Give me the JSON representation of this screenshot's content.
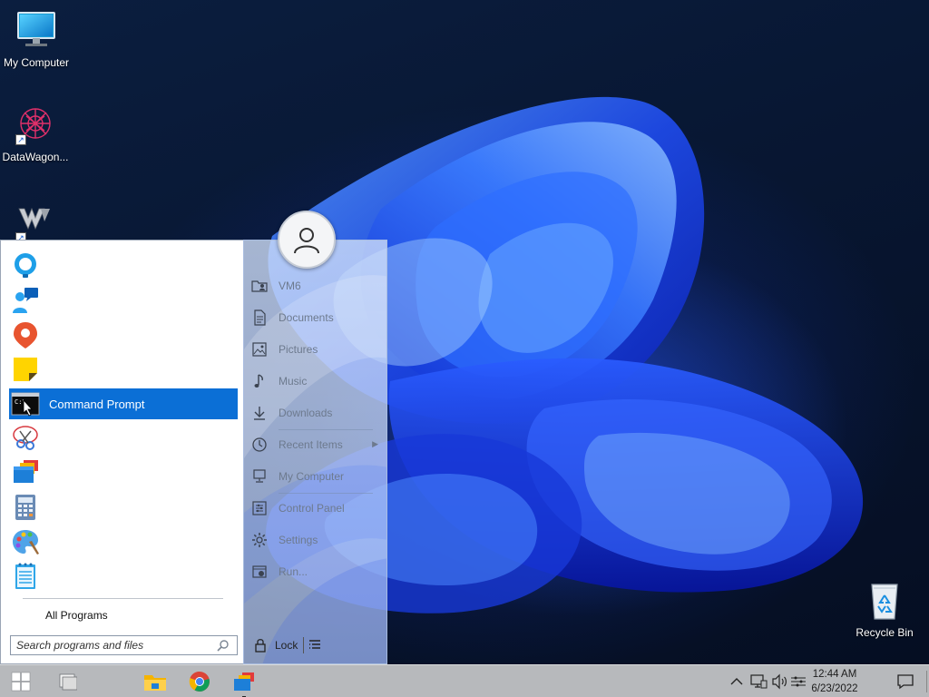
{
  "desktop": {
    "icons": [
      {
        "label": "My Computer",
        "icon": "monitor-icon"
      },
      {
        "label": "DataWagon...",
        "icon": "datawagon-icon"
      },
      {
        "label": "",
        "icon": "winstep-shortcut-icon"
      },
      {
        "label": "Recycle Bin",
        "icon": "recycle-bin-icon"
      }
    ]
  },
  "start_menu": {
    "programs": [
      {
        "label": "",
        "icon": "tips-lightbulb-icon"
      },
      {
        "label": "",
        "icon": "people-chat-icon"
      },
      {
        "label": "",
        "icon": "maps-pin-icon"
      },
      {
        "label": "",
        "icon": "sticky-notes-icon"
      },
      {
        "label": "Command Prompt",
        "icon": "command-prompt-icon",
        "selected": true
      },
      {
        "label": "",
        "icon": "snipping-tool-icon"
      },
      {
        "label": "",
        "icon": "file-explorer-folders-icon"
      },
      {
        "label": "",
        "icon": "calculator-icon"
      },
      {
        "label": "",
        "icon": "paint-icon"
      },
      {
        "label": "",
        "icon": "notepad-icon"
      }
    ],
    "all_programs": "All Programs",
    "search_placeholder": "Search programs and files",
    "places": [
      {
        "label": "VM6",
        "icon": "user-folder-icon"
      },
      {
        "label": "Documents",
        "icon": "document-icon"
      },
      {
        "label": "Pictures",
        "icon": "picture-icon"
      },
      {
        "label": "Music",
        "icon": "music-note-icon"
      },
      {
        "label": "Downloads",
        "icon": "download-arrow-icon"
      },
      {
        "label": "Recent Items",
        "icon": "clock-icon",
        "submenu": true
      },
      {
        "label": "My Computer",
        "icon": "computer-icon"
      },
      {
        "label": "Control Panel",
        "icon": "control-panel-icon"
      },
      {
        "label": "Settings",
        "icon": "gear-icon"
      },
      {
        "label": "Run...",
        "icon": "run-icon"
      }
    ],
    "lock_label": "Lock"
  },
  "taskbar": {
    "buttons": [
      "start-button",
      "task-view-button",
      "file-explorer-taskbar-button",
      "chrome-taskbar-button",
      "winstep-taskbar-button"
    ],
    "clock_time": "12:44 AM",
    "clock_date": "6/23/2022"
  },
  "colors": {
    "selection": "#0b6fd6",
    "taskbar": "#b7b9bc",
    "wallpaper_bloom": "#1f4fff"
  }
}
